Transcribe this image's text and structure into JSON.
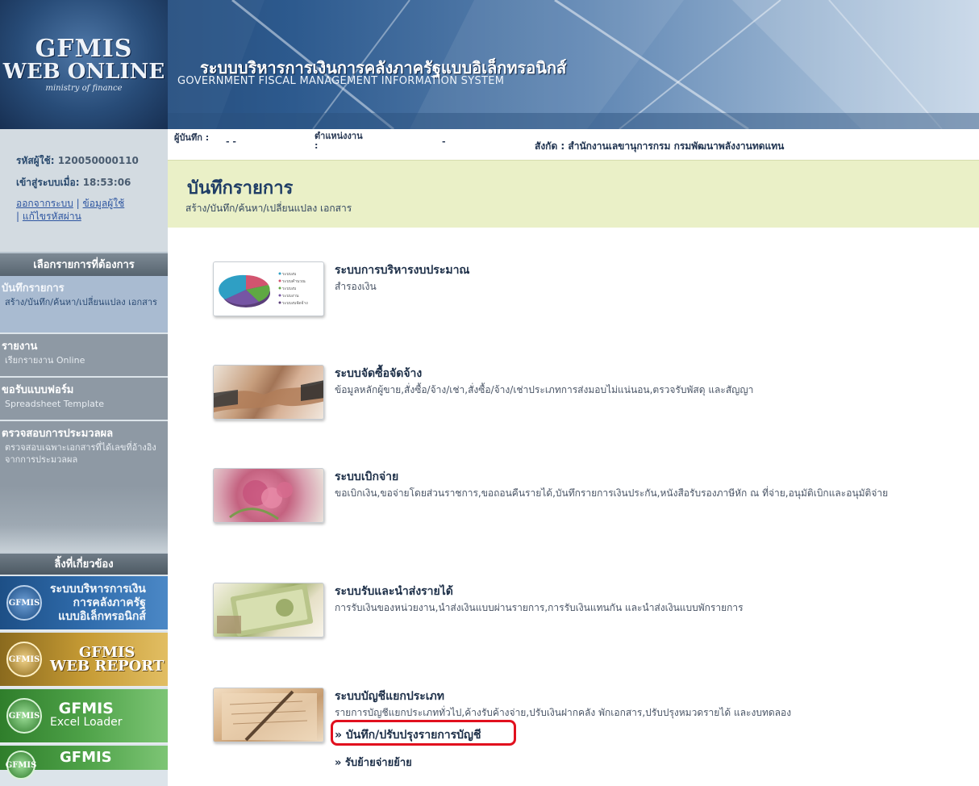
{
  "header": {
    "logo_line1": "GFMIS",
    "logo_line2": "WEB ONLINE",
    "logo_line3": "ministry of finance",
    "title_th": "ระบบบริหารการเงินการคลังภาครัฐแบบอิเล็กทรอนิกส์",
    "title_en": "GOVERNMENT FISCAL MANAGEMENT INFORMATION SYSTEM"
  },
  "user": {
    "id_label": "รหัสผู้ใช้:",
    "id_value": "120050000110",
    "login_label": "เข้าสู่ระบบเมื่อ:",
    "login_time": "18:53:06",
    "logout": "ออกจากระบบ",
    "separator": "|",
    "profile": "ข้อมูลผู้ใช้",
    "change_password": "แก้ไขรหัสผ่าน"
  },
  "sidebar": {
    "menu_header": "เลือกรายการที่ต้องการ",
    "items": [
      {
        "title": "บันทึกรายการ",
        "sub": "สร้าง/บันทึก/ค้นหา/เปลี่ยนแปลง เอกสาร"
      },
      {
        "title": "รายงาน",
        "sub": "เรียกรายงาน Online"
      },
      {
        "title": "ขอรับแบบฟอร์ม",
        "sub": "Spreadsheet Template"
      },
      {
        "title": "ตรวจสอบการประมวลผล",
        "sub": "ตรวจสอบเฉพาะเอกสารที่ได้เลขที่อ้างอิงจากการประมวลผล"
      }
    ],
    "related_header": "ลิ้งที่เกี่ยวข้อง",
    "banners": [
      {
        "logo": "GFMIS",
        "text_line1": "ระบบบริหารการเงิน",
        "text_line2": "การคลังภาครัฐ",
        "text_line3": "แบบอิเล็กทรอนิกส์"
      },
      {
        "logo": "GFMIS",
        "text_line1": "GFMIS",
        "text_line2": "WEB REPORT"
      },
      {
        "logo": "GFMIS",
        "text_line1": "GFMIS",
        "text_line2": "Excel Loader"
      },
      {
        "logo": "GFMIS",
        "text_line1": "GFMIS"
      }
    ]
  },
  "info_bar": {
    "recorder_label": "ผู้บันทึก :",
    "recorder_value": "- -",
    "position_label": "ตำแหน่งงาน :",
    "position_value": "-",
    "affiliation": "สังกัด : สำนักงานเลขานุการกรม กรมพัฒนาพลังงานทดแทน"
  },
  "page": {
    "title": "บันทึกรายการ",
    "subtitle": "สร้าง/บันทึก/ค้นหา/เปลี่ยนแปลง เอกสาร"
  },
  "cards": [
    {
      "title": "ระบบการบริหารงบประมาณ",
      "desc": "สำรองเงิน"
    },
    {
      "title": "ระบบจัดซื้อจัดจ้าง",
      "desc": "ข้อมูลหลักผู้ขาย,สั่งซื้อ/จ้าง/เช่า,สั่งซื้อ/จ้าง/เช่าประเภทการส่งมอบไม่แน่นอน,ตรวจรับพัสดุ และสัญญา"
    },
    {
      "title": "ระบบเบิกจ่าย",
      "desc": "ขอเบิกเงิน,ขอจ่ายโดยส่วนราชการ,ขอถอนคืนรายได้,บันทึกรายการเงินประกัน,หนังสือรับรองภาษีหัก ณ ที่จ่าย,อนุมัติเบิกและอนุมัติจ่าย"
    },
    {
      "title": "ระบบรับและนำส่งรายได้",
      "desc": "การรับเงินของหน่วยงาน,นำส่งเงินแบบผ่านรายการ,การรับเงินแทนกัน และนำส่งเงินแบบพักรายการ"
    },
    {
      "title": "ระบบบัญชีแยกประเภท",
      "desc": "รายการบัญชีแยกประเภททั่วไป,ค้างรับค้างจ่าย,ปรับเงินฝากคลัง พักเอกสาร,ปรับปรุงหมวดรายได้ และงบทดลอง"
    }
  ],
  "ledger_links": {
    "adjust": "» บันทึก/ปรับปรุงรายการบัญชี",
    "transfer": "» รับย้ายจ่ายย้าย"
  },
  "pie_legend": [
    "ระบบงบ",
    "ระบบคำนวณ",
    "ระบบงบ",
    "ระบบงาน",
    "ระบบงบจัดจ้าง"
  ],
  "colors": {
    "accent_red": "#e1101e",
    "title_banner": "#eaf0c7",
    "header_dark": "#1f3f69"
  }
}
